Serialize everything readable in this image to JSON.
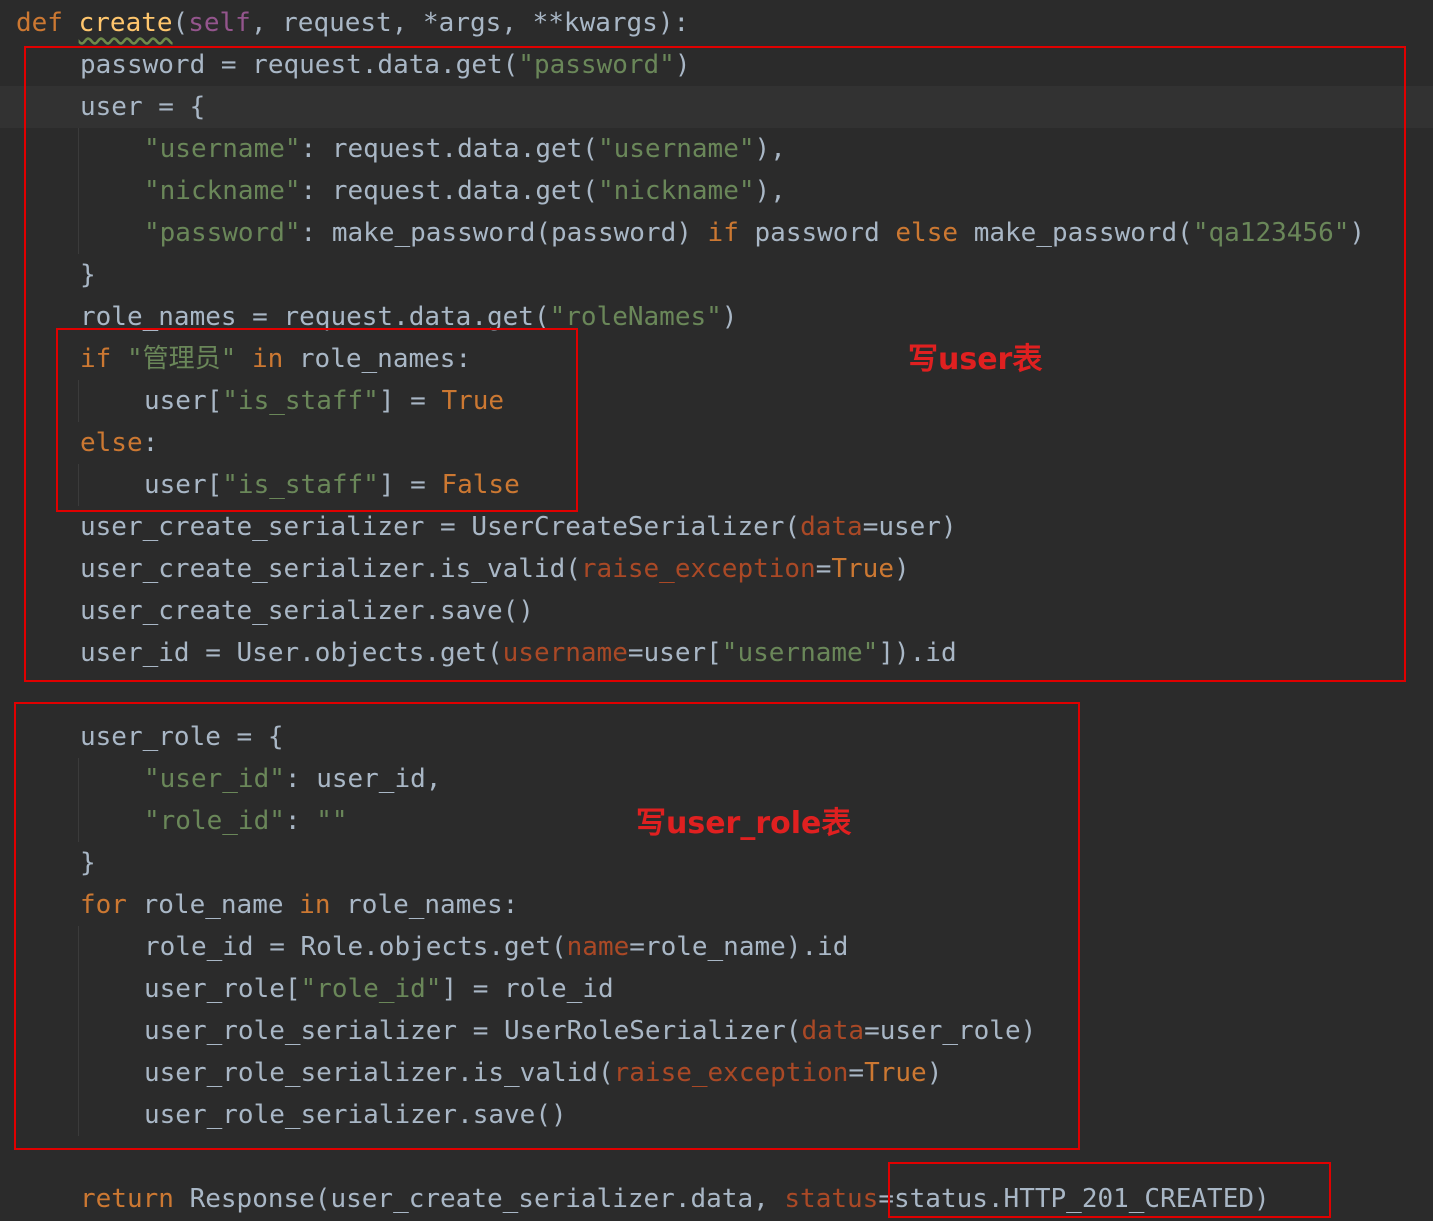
{
  "code_lines": [
    {
      "tokens": [
        {
          "t": "def ",
          "c": "kw"
        },
        {
          "t": "create",
          "c": "fn"
        },
        {
          "t": "(",
          "c": "plain"
        },
        {
          "t": "self",
          "c": "self"
        },
        {
          "t": ", request, ",
          "c": "plain"
        },
        {
          "t": "*args",
          "c": "plain"
        },
        {
          "t": ", ",
          "c": "plain"
        },
        {
          "t": "**kwargs",
          "c": "plain"
        },
        {
          "t": "):",
          "c": "plain"
        }
      ]
    },
    {
      "tokens": [
        {
          "t": "password = request.data.get(",
          "c": "plain"
        },
        {
          "t": "\"password\"",
          "c": "str"
        },
        {
          "t": ")",
          "c": "plain"
        }
      ]
    },
    {
      "tokens": [
        {
          "t": "user = {",
          "c": "plain"
        }
      ]
    },
    {
      "tokens": [
        {
          "t": "\"username\"",
          "c": "str"
        },
        {
          "t": ": request.data.get(",
          "c": "plain"
        },
        {
          "t": "\"username\"",
          "c": "str"
        },
        {
          "t": "),",
          "c": "plain"
        }
      ]
    },
    {
      "tokens": [
        {
          "t": "\"nickname\"",
          "c": "str"
        },
        {
          "t": ": request.data.get(",
          "c": "plain"
        },
        {
          "t": "\"nickname\"",
          "c": "str"
        },
        {
          "t": "),",
          "c": "plain"
        }
      ]
    },
    {
      "tokens": [
        {
          "t": "\"password\"",
          "c": "str"
        },
        {
          "t": ": make_password(password) ",
          "c": "plain"
        },
        {
          "t": "if ",
          "c": "kw"
        },
        {
          "t": "password ",
          "c": "plain"
        },
        {
          "t": "else ",
          "c": "kw"
        },
        {
          "t": "make_password(",
          "c": "plain"
        },
        {
          "t": "\"qa123456\"",
          "c": "str"
        },
        {
          "t": ")",
          "c": "plain"
        }
      ]
    },
    {
      "tokens": [
        {
          "t": "}",
          "c": "plain"
        }
      ]
    },
    {
      "tokens": [
        {
          "t": "role_names = request.data.get(",
          "c": "plain"
        },
        {
          "t": "\"roleNames\"",
          "c": "str"
        },
        {
          "t": ")",
          "c": "plain"
        }
      ]
    },
    {
      "tokens": [
        {
          "t": "if ",
          "c": "kw"
        },
        {
          "t": "\"管理员\" ",
          "c": "str"
        },
        {
          "t": "in ",
          "c": "kw"
        },
        {
          "t": "role_names:",
          "c": "plain"
        }
      ]
    },
    {
      "tokens": [
        {
          "t": "user[",
          "c": "plain"
        },
        {
          "t": "\"is_staff\"",
          "c": "str"
        },
        {
          "t": "] = ",
          "c": "plain"
        },
        {
          "t": "True",
          "c": "kw"
        }
      ]
    },
    {
      "tokens": [
        {
          "t": "else",
          "c": "kw"
        },
        {
          "t": ":",
          "c": "plain"
        }
      ]
    },
    {
      "tokens": [
        {
          "t": "user[",
          "c": "plain"
        },
        {
          "t": "\"is_staff\"",
          "c": "str"
        },
        {
          "t": "] = ",
          "c": "plain"
        },
        {
          "t": "False",
          "c": "kw"
        }
      ]
    },
    {
      "tokens": [
        {
          "t": "user_create_serializer = UserCreateSerializer(",
          "c": "plain"
        },
        {
          "t": "data",
          "c": "param"
        },
        {
          "t": "=user)",
          "c": "plain"
        }
      ]
    },
    {
      "tokens": [
        {
          "t": "user_create_serializer.is_valid(",
          "c": "plain"
        },
        {
          "t": "raise_exception",
          "c": "param"
        },
        {
          "t": "=",
          "c": "plain"
        },
        {
          "t": "True",
          "c": "kw"
        },
        {
          "t": ")",
          "c": "plain"
        }
      ]
    },
    {
      "tokens": [
        {
          "t": "user_create_serializer.save()",
          "c": "plain"
        }
      ]
    },
    {
      "tokens": [
        {
          "t": "user_id = User.objects.get(",
          "c": "plain"
        },
        {
          "t": "username",
          "c": "param"
        },
        {
          "t": "=user[",
          "c": "plain"
        },
        {
          "t": "\"username\"",
          "c": "str"
        },
        {
          "t": "]).id",
          "c": "plain"
        }
      ]
    },
    {
      "tokens": []
    },
    {
      "tokens": [
        {
          "t": "user_role = {",
          "c": "plain"
        }
      ]
    },
    {
      "tokens": [
        {
          "t": "\"user_id\"",
          "c": "str"
        },
        {
          "t": ": user_id,",
          "c": "plain"
        }
      ]
    },
    {
      "tokens": [
        {
          "t": "\"role_id\"",
          "c": "str"
        },
        {
          "t": ": ",
          "c": "plain"
        },
        {
          "t": "\"\"",
          "c": "str"
        }
      ]
    },
    {
      "tokens": [
        {
          "t": "}",
          "c": "plain"
        }
      ]
    },
    {
      "tokens": [
        {
          "t": "for ",
          "c": "kw"
        },
        {
          "t": "role_name ",
          "c": "plain"
        },
        {
          "t": "in ",
          "c": "kw"
        },
        {
          "t": "role_names:",
          "c": "plain"
        }
      ]
    },
    {
      "tokens": [
        {
          "t": "role_id = Role.objects.get(",
          "c": "plain"
        },
        {
          "t": "name",
          "c": "param"
        },
        {
          "t": "=role_name).id",
          "c": "plain"
        }
      ]
    },
    {
      "tokens": [
        {
          "t": "user_role[",
          "c": "plain"
        },
        {
          "t": "\"role_id\"",
          "c": "str"
        },
        {
          "t": "] = role_id",
          "c": "plain"
        }
      ]
    },
    {
      "tokens": [
        {
          "t": "user_role_serializer = UserRoleSerializer(",
          "c": "plain"
        },
        {
          "t": "data",
          "c": "param"
        },
        {
          "t": "=user_role)",
          "c": "plain"
        }
      ]
    },
    {
      "tokens": [
        {
          "t": "user_role_serializer.is_valid(",
          "c": "plain"
        },
        {
          "t": "raise_exception",
          "c": "param"
        },
        {
          "t": "=",
          "c": "plain"
        },
        {
          "t": "True",
          "c": "kw"
        },
        {
          "t": ")",
          "c": "plain"
        }
      ]
    },
    {
      "tokens": [
        {
          "t": "user_role_serializer.save()",
          "c": "plain"
        }
      ]
    },
    {
      "tokens": []
    },
    {
      "tokens": [
        {
          "t": "return ",
          "c": "kw"
        },
        {
          "t": "Response(user_create_serializer.data, ",
          "c": "plain"
        },
        {
          "t": "status",
          "c": "param"
        },
        {
          "t": "=status.HTTP_201_CREATED)",
          "c": "plain"
        }
      ]
    }
  ],
  "annotations": {
    "user_table_note": "写user表",
    "user_role_table_note": "写user_role表"
  },
  "colors": {
    "background": "#2b2b2b",
    "keyword": "#cc7832",
    "string": "#6a8759",
    "param": "#aa4926",
    "self": "#94558d",
    "plain": "#a9b7c6",
    "highlight_box": "#e00000"
  }
}
